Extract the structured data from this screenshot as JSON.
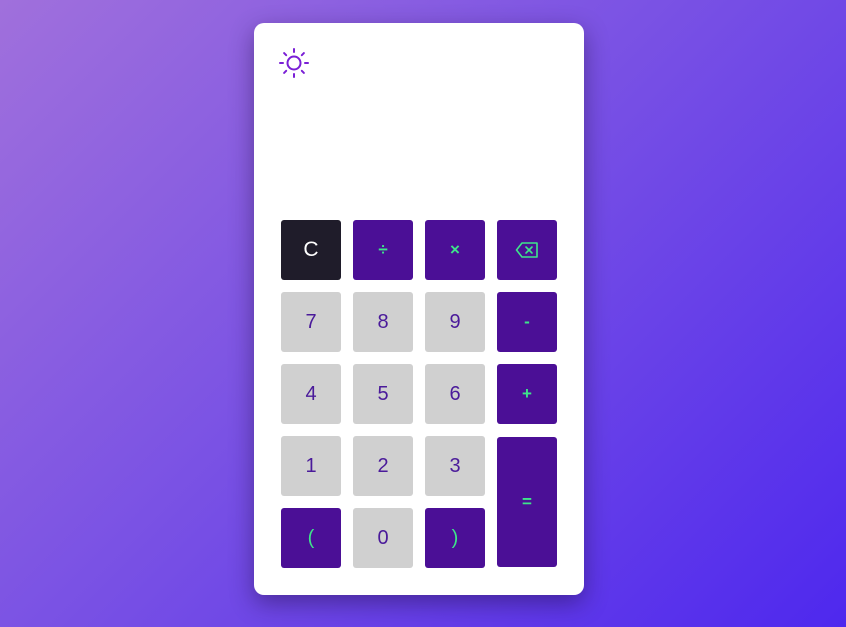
{
  "theme_toggle": {
    "icon": "sun-icon",
    "icon_color": "#7a1fd6"
  },
  "display": {
    "value": ""
  },
  "colors": {
    "number_key_bg": "#d0d0d0",
    "number_key_text": "#4a1a9a",
    "operator_key_bg": "#4b0f96",
    "operator_key_text": "#3ee58a",
    "clear_key_bg": "#1f1c2a",
    "clear_key_text": "#ffffff"
  },
  "keys": {
    "clear": "C",
    "divide": "÷",
    "multiply": "×",
    "backspace": "⌫",
    "seven": "7",
    "eight": "8",
    "nine": "9",
    "minus": "-",
    "four": "4",
    "five": "5",
    "six": "6",
    "plus": "+",
    "one": "1",
    "two": "2",
    "three": "3",
    "equals": "=",
    "open_paren": "(",
    "zero": "0",
    "close_paren": ")"
  }
}
